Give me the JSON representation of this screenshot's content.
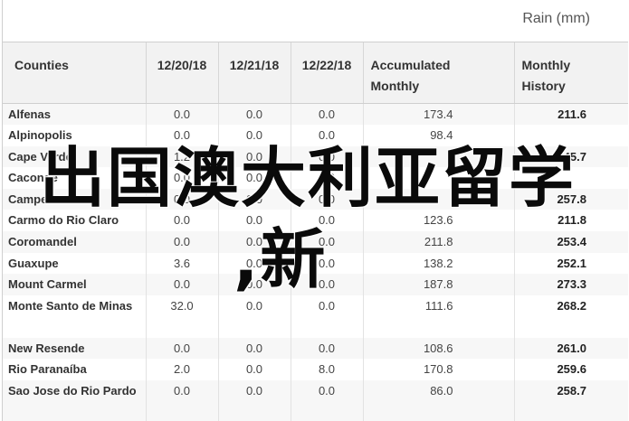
{
  "caption": "Rain (mm)",
  "columns": [
    "Counties",
    "12/20/18",
    "12/21/18",
    "12/22/18",
    "Accumulated Monthly",
    "Monthly History"
  ],
  "rows": [
    {
      "county": "Alfenas",
      "d1": "0.0",
      "d2": "0.0",
      "d3": "0.0",
      "acc": "173.4",
      "hist": "211.6"
    },
    {
      "county": "Alpinopolis",
      "d1": "0.0",
      "d2": "0.0",
      "d3": "0.0",
      "acc": "98.4",
      "hist": ""
    },
    {
      "county": "Cape Verde",
      "d1": "1.2",
      "d2": "0.0",
      "d3": "0.0",
      "acc": "",
      "hist": "245.7"
    },
    {
      "county": "Caconde",
      "d1": "0.0",
      "d2": "0.0",
      "d3": "0.0",
      "acc": "",
      "hist": ""
    },
    {
      "county": "Campestre",
      "d1": "0.0",
      "d2": "0.0",
      "d3": "0.0",
      "acc": "",
      "hist": "257.8"
    },
    {
      "county": "Carmo do Rio Claro",
      "d1": "0.0",
      "d2": "0.0",
      "d3": "0.0",
      "acc": "123.6",
      "hist": "211.8"
    },
    {
      "county": "Coromandel",
      "d1": "0.0",
      "d2": "0.0",
      "d3": "0.0",
      "acc": "211.8",
      "hist": "253.4"
    },
    {
      "county": "Guaxupe",
      "d1": "3.6",
      "d2": "0.0",
      "d3": "0.0",
      "acc": "138.2",
      "hist": "252.1"
    },
    {
      "county": "Mount Carmel",
      "d1": "0.0",
      "d2": "0.0",
      "d3": "0.0",
      "acc": "187.8",
      "hist": "273.3"
    },
    {
      "county": "Monte Santo de Minas",
      "d1": "32.0",
      "d2": "0.0",
      "d3": "0.0",
      "acc": "111.6",
      "hist": "268.2"
    },
    {
      "county": "New Resende",
      "d1": "0.0",
      "d2": "0.0",
      "d3": "0.0",
      "acc": "108.6",
      "hist": "261.0"
    },
    {
      "county": "Rio Paranaíba",
      "d1": "2.0",
      "d2": "0.0",
      "d3": "8.0",
      "acc": "170.8",
      "hist": "259.6"
    },
    {
      "county": "Sao Jose do Rio Pardo",
      "d1": "0.0",
      "d2": "0.0",
      "d3": "0.0",
      "acc": "86.0",
      "hist": "258.7"
    }
  ],
  "watermark": {
    "line1": "出国澳大利亚留学",
    "line2": ",新"
  }
}
